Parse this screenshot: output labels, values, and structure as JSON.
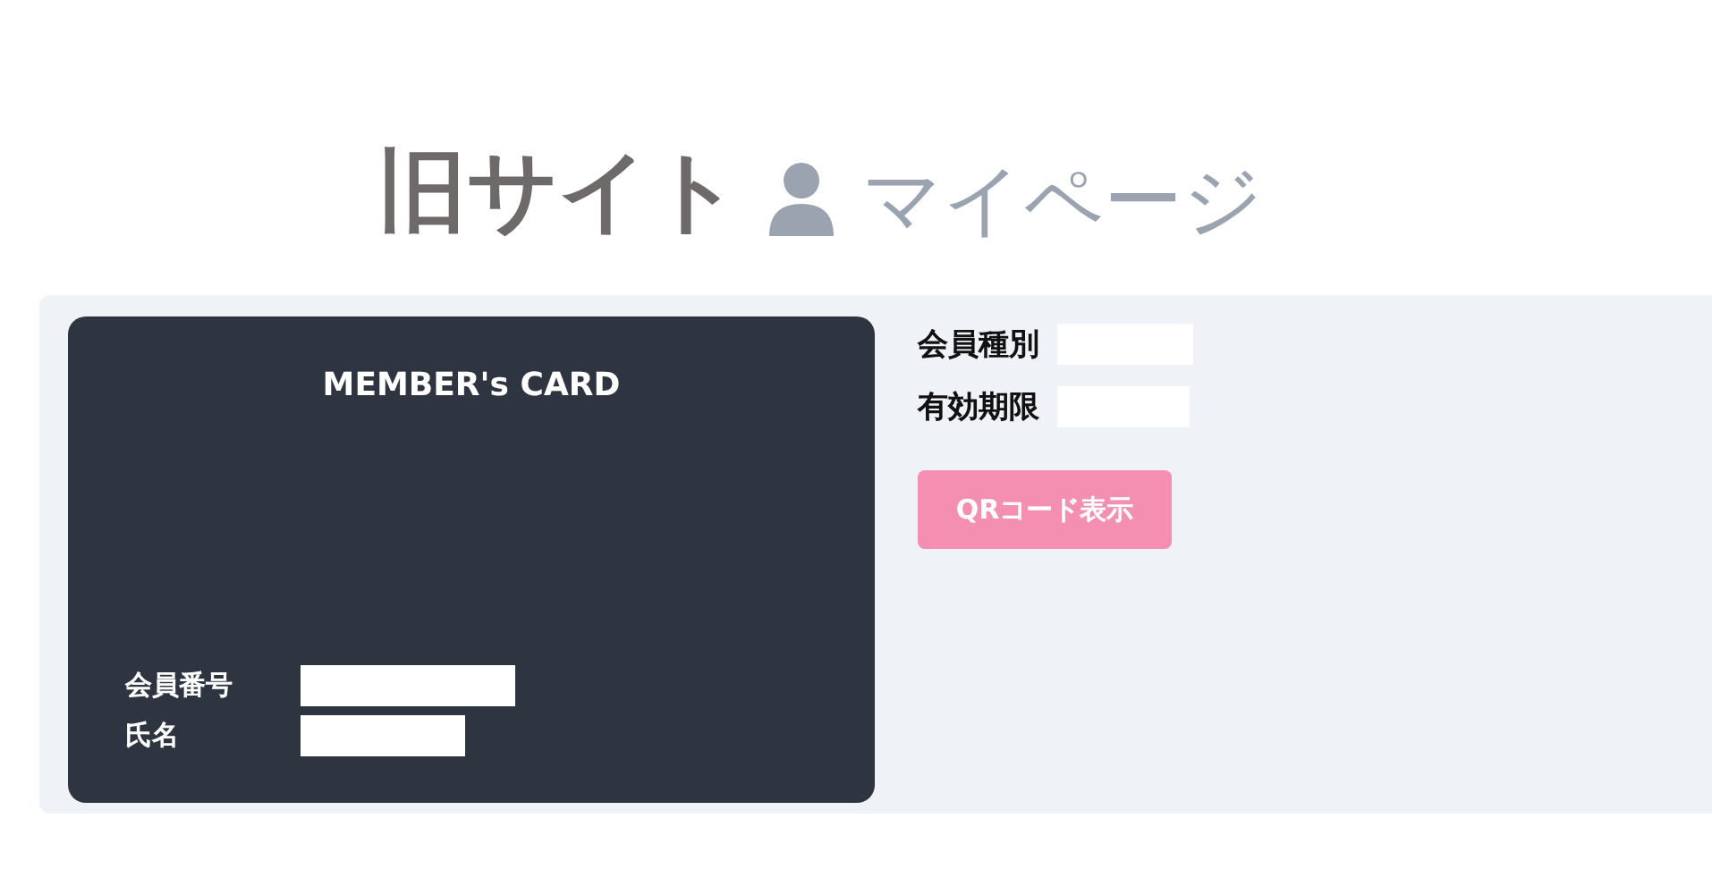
{
  "header": {
    "site_label": "旧サイト",
    "page_title": "マイページ"
  },
  "card": {
    "title": "MEMBER's CARD",
    "fields": [
      {
        "label": "会員番号"
      },
      {
        "label": "氏名"
      }
    ]
  },
  "info": {
    "fields": [
      {
        "label": "会員種別"
      },
      {
        "label": "有効期限"
      }
    ]
  },
  "qr_button": {
    "label": "QRコード表示"
  }
}
